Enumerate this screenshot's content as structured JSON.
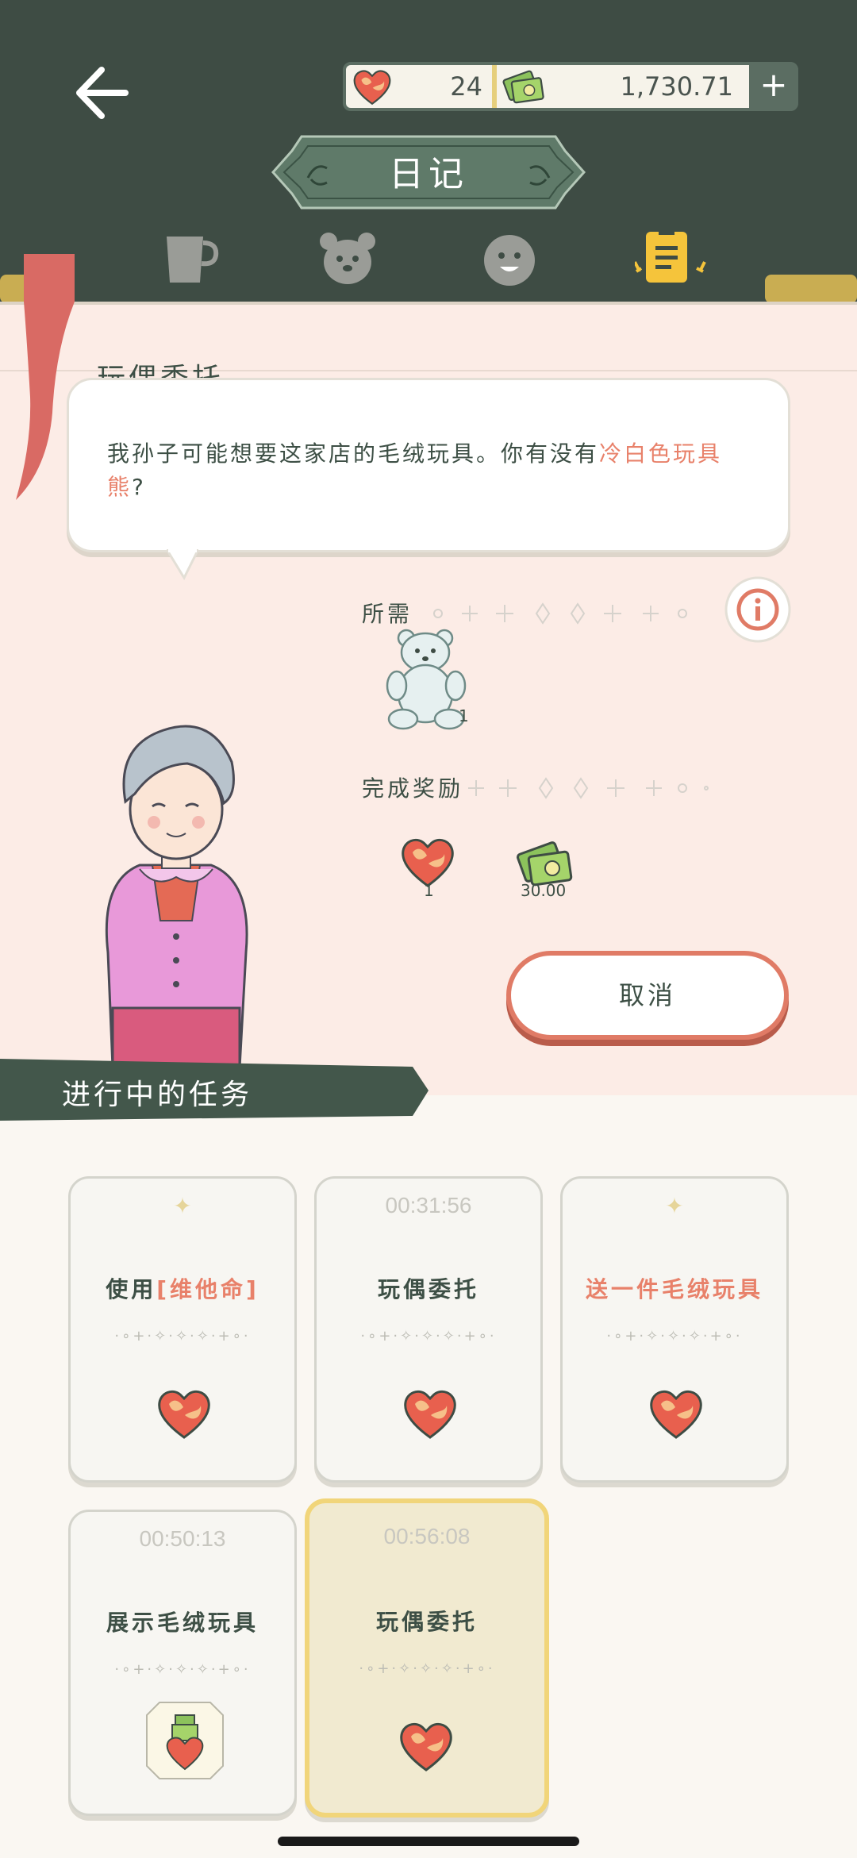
{
  "header": {
    "title": "日记",
    "hearts": "24",
    "money": "1,730.71",
    "plus": "+"
  },
  "tabs": [
    "cup-icon",
    "bear-icon",
    "smile-icon",
    "diary-icon"
  ],
  "commission": {
    "section_title": "玩偶委托",
    "speech_text": "我孙子可能想要这家店的毛绒玩具。你有没有",
    "speech_highlight": "冷白色玩具熊",
    "speech_end": "?",
    "required_label": "所需",
    "required_item": {
      "icon": "bear-icon",
      "count": "1"
    },
    "reward_label": "完成奖励",
    "rewards": [
      {
        "icon": "heart-icon",
        "value": "1"
      },
      {
        "icon": "money-icon",
        "value": "30.00"
      }
    ],
    "cancel_label": "取消"
  },
  "ongoing": {
    "title": "进行中的任务",
    "tasks": [
      {
        "time": "",
        "title_prefix": "使用",
        "title_highlight": "[维他命]",
        "reward": "heart-icon"
      },
      {
        "time": "00:31:56",
        "title": "玩偶委托",
        "reward": "heart-icon"
      },
      {
        "time": "",
        "title": "送一件毛绒玩具",
        "reward": "heart-icon"
      },
      {
        "time": "00:50:13",
        "title": "展示毛绒玩具",
        "reward": "gift-heart-icon"
      },
      {
        "time": "00:56:08",
        "title": "玩偶委托",
        "reward": "heart-icon"
      }
    ],
    "deco": "·∘+·✧·✧·✧·+∘·"
  },
  "colors": {
    "header_bg": "#3e4c44",
    "accent_green": "#5b6d62",
    "accent_red": "#e07b66",
    "card_bg": "#fcece6"
  }
}
